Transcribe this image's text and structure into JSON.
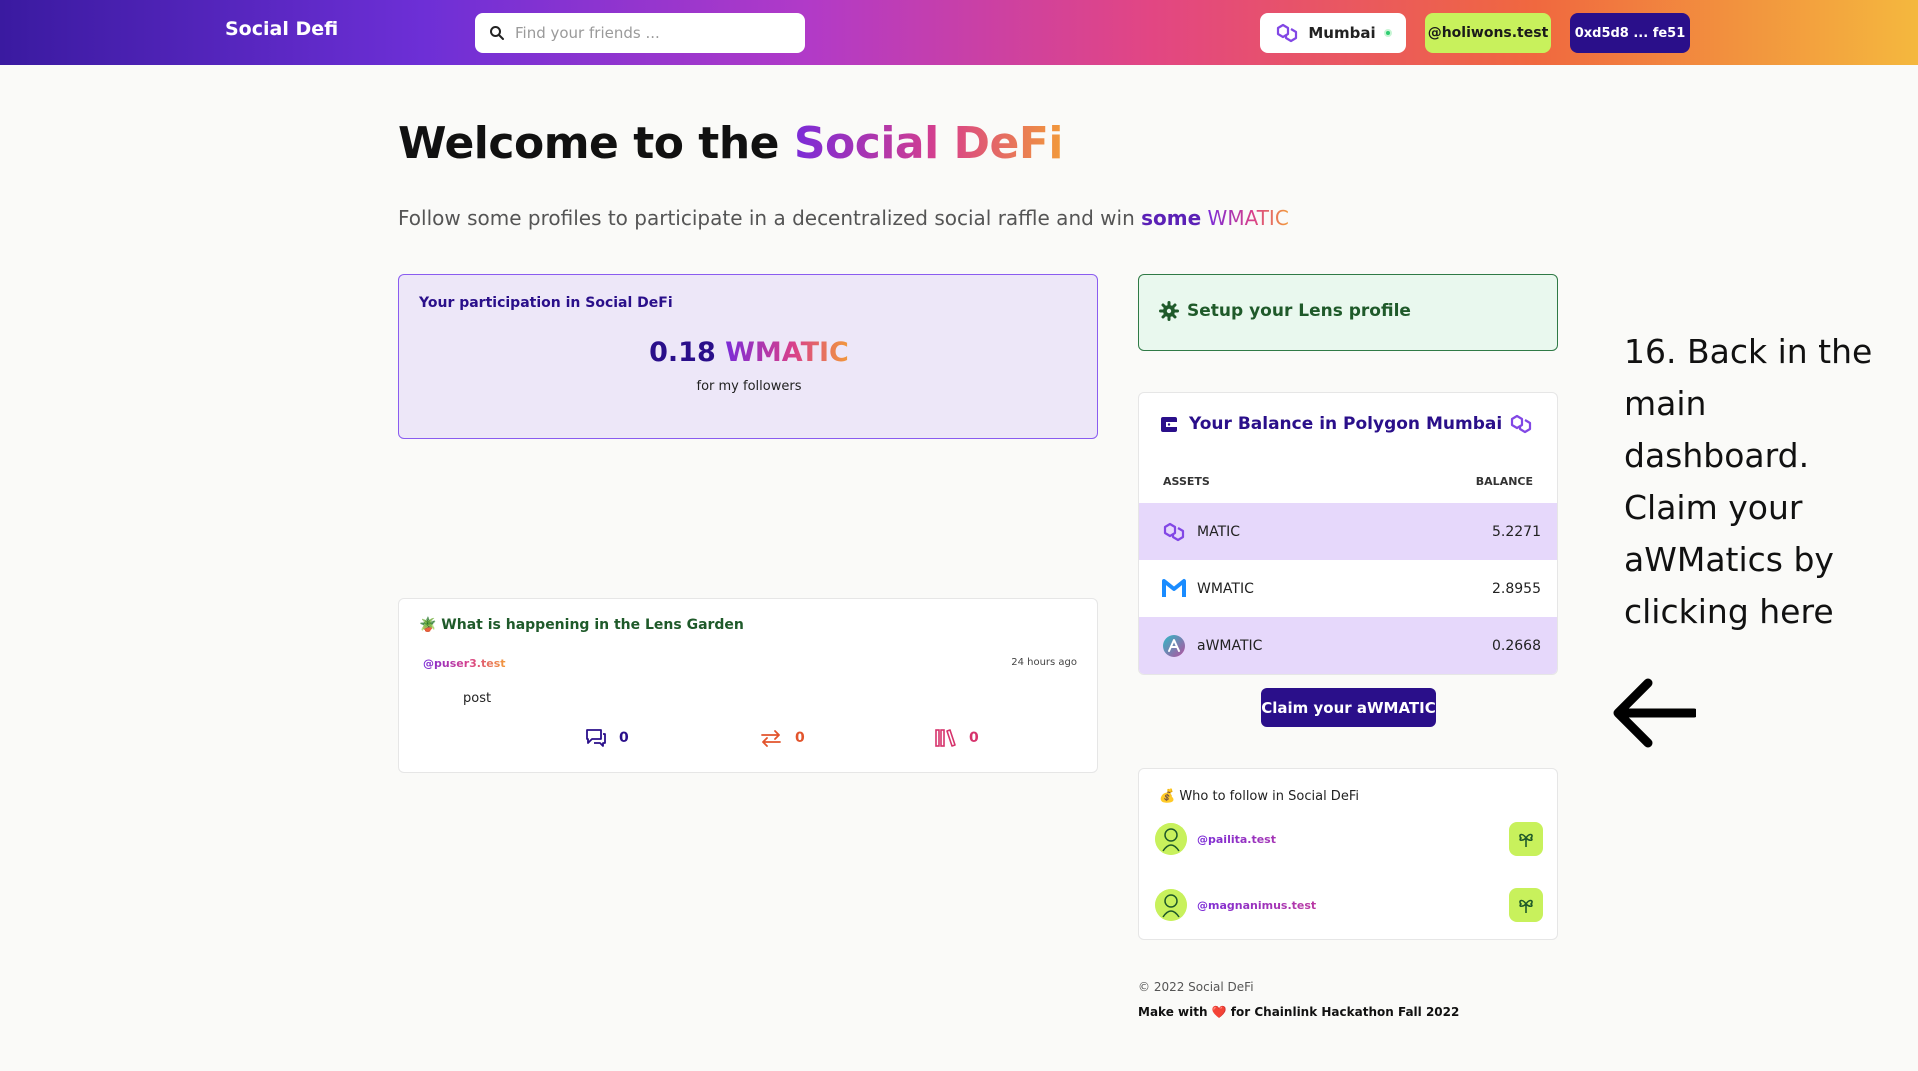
{
  "header": {
    "brand": "Social Defi",
    "search_placeholder": "Find your friends ...",
    "network": "Mumbai",
    "handle": "@holiwons.test",
    "address": "0xd5d8 ... fe51"
  },
  "hero": {
    "title_plain": "Welcome to the ",
    "title_accent": "Social DeFi",
    "subtitle_plain": "Follow some profiles to participate in a decentralized social raffle and win ",
    "subtitle_some": "some",
    "subtitle_token": "WMATIC"
  },
  "participation": {
    "label": "Your participation in Social DeFi",
    "amount": "0.18",
    "token": "WMATIC",
    "note": "for my followers"
  },
  "feed": {
    "title": "🪴 What is happening in the Lens Garden",
    "user": "@puser3.test",
    "time": "24 hours ago",
    "post": "post",
    "comments": "0",
    "mirrors": "0",
    "collects": "0"
  },
  "setup": {
    "label": "Setup your Lens profile"
  },
  "balance": {
    "title": "Your Balance in Polygon Mumbai",
    "col_assets": "ASSETS",
    "col_balance": "BALANCE",
    "rows": [
      {
        "asset": "MATIC",
        "value": "5.2271",
        "icon": "polygon-icon"
      },
      {
        "asset": "WMATIC",
        "value": "2.8955",
        "icon": "wmatic-icon"
      },
      {
        "asset": "aWMATIC",
        "value": "0.2668",
        "icon": "aave-icon"
      }
    ],
    "claim_label": "Claim your aWMATIC"
  },
  "follow": {
    "title": "💰 Who to follow in Social DeFi",
    "profiles": [
      {
        "handle": "@pailita.test"
      },
      {
        "handle": "@magnanimus.test"
      }
    ]
  },
  "footer": {
    "copyright": "© 2022 Social DeFi",
    "credit": "Make with ❤️ for Chainlink Hackathon Fall 2022"
  },
  "annotation": {
    "text": "16. Back in the main dashboard. Claim your aWMatics by clicking here"
  }
}
